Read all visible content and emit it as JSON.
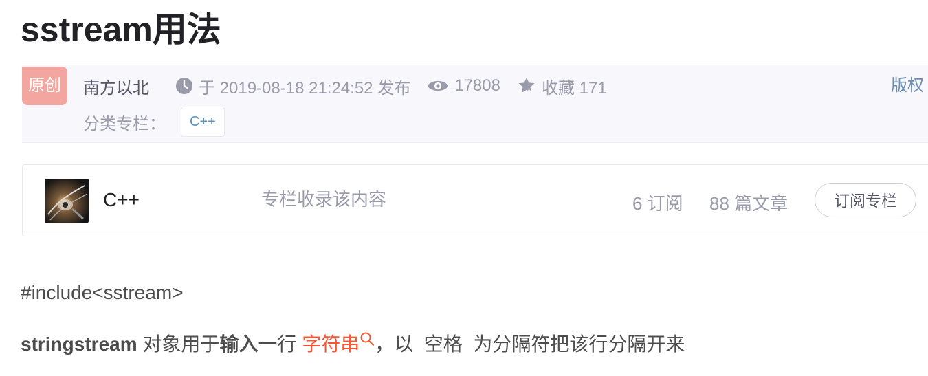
{
  "article": {
    "title": "sstream用法",
    "original_badge": "原创",
    "author": "南方以北",
    "published": "于 2019-08-18 21:24:52 发布",
    "views": "17808",
    "favorites": "收藏 171",
    "copyright_label": "版权",
    "category_label": "分类专栏：",
    "category_tag": "C++"
  },
  "column_card": {
    "name": "C++",
    "description": "专栏收录该内容",
    "subscribers": "6 订阅",
    "articles": "88 篇文章",
    "subscribe_button": "订阅专栏"
  },
  "content": {
    "line1": "#include<sstream>",
    "line2": {
      "bold_term": "stringstream",
      "text_a": " 对象用于",
      "bold_input": "输入",
      "text_b": "一行 ",
      "link_keyword": "字符串",
      "text_c": "，以  空格  为分隔符把该行分隔开来"
    }
  },
  "colors": {
    "title": "#222226",
    "meta_bg": "#f7f7fc",
    "badge": "#f3a6a0",
    "link_blue": "#5893c2",
    "keyword_red": "#fc5531",
    "muted": "#999aaa"
  }
}
